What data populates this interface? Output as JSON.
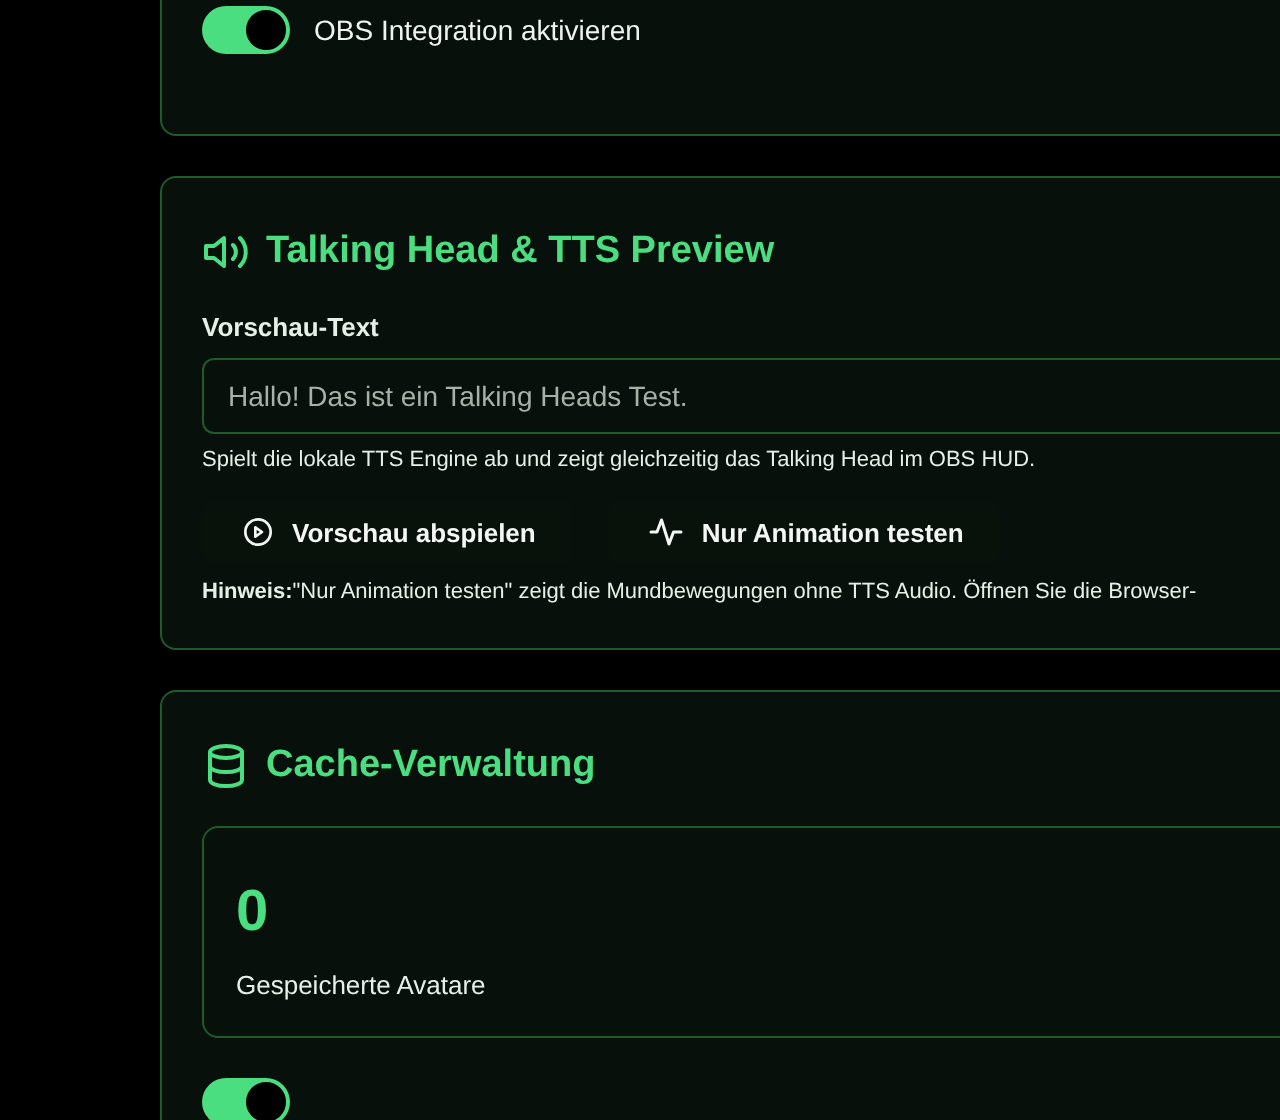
{
  "obs_card": {
    "toggle": {
      "label": "OBS Integration aktivieren",
      "on": true
    }
  },
  "preview_card": {
    "title": "Talking Head & TTS Preview",
    "field_label": "Vorschau-Text",
    "field_value": "Hallo! Das ist ein Talking Heads Test.",
    "help": "Spielt die lokale TTS Engine ab und zeigt gleichzeitig das Talking Head im OBS HUD.",
    "buttons": [
      {
        "label": "Vorschau abspielen",
        "kind": "play"
      },
      {
        "label": "Nur Animation testen",
        "kind": "pulse"
      }
    ],
    "hint": "**Hinweis:**\"Nur Animation testen\" zeigt die Mundbewegungen ohne TTS Audio. Öffnen Sie die Browser-"
  },
  "cache_card": {
    "title": "Cache-Verwaltung",
    "stat": {
      "value": "0",
      "label": "Gespeicherte Avatare"
    },
    "toggle": {
      "on": true
    }
  }
}
